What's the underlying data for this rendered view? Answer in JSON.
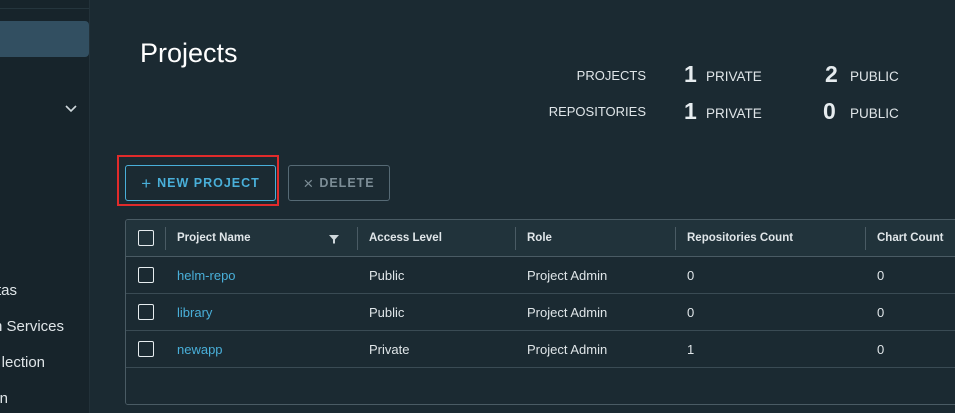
{
  "sidebar": {
    "items": [
      {
        "label": "tas"
      },
      {
        "label": "n Services"
      },
      {
        "label": "lection"
      },
      {
        "label": "n"
      }
    ]
  },
  "page": {
    "title": "Projects"
  },
  "stats": {
    "projects": {
      "label": "PROJECTS",
      "private_count": "1",
      "private_label": "PRIVATE",
      "public_count": "2",
      "public_label": "PUBLIC"
    },
    "repositories": {
      "label": "REPOSITORIES",
      "private_count": "1",
      "private_label": "PRIVATE",
      "public_count": "0",
      "public_label": "PUBLIC"
    }
  },
  "toolbar": {
    "new_project_label": "NEW PROJECT",
    "delete_label": "DELETE"
  },
  "grid": {
    "columns": [
      "Project Name",
      "Access Level",
      "Role",
      "Repositories Count",
      "Chart Count"
    ],
    "rows": [
      {
        "name": "helm-repo",
        "access": "Public",
        "role": "Project Admin",
        "repos": "0",
        "charts": "0"
      },
      {
        "name": "library",
        "access": "Public",
        "role": "Project Admin",
        "repos": "0",
        "charts": "0"
      },
      {
        "name": "newapp",
        "access": "Private",
        "role": "Project Admin",
        "repos": "1",
        "charts": "0"
      }
    ]
  },
  "colors": {
    "accent": "#49afd9",
    "highlight": "#e12b2b",
    "background": "#1b2a32",
    "sidebar": "#17242b"
  }
}
